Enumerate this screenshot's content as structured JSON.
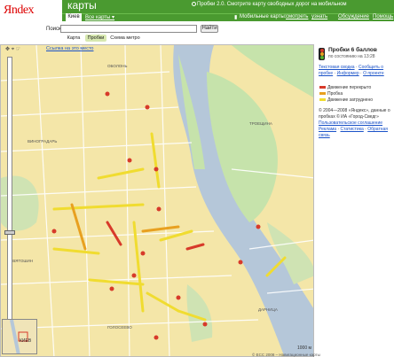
{
  "header": {
    "logo": "Яndex",
    "service_title": "карты",
    "promo_text": "Пробки 2.0. Смотрите карту свободных дорог на мобильном"
  },
  "nav": {
    "city": "Киев",
    "all_maps": "Все карты ▾",
    "mobile_label": "Мобильные карты:",
    "mobile_view": "смотреть",
    "mobile_install": "узнать",
    "feedback": "Обсуждение",
    "help": "Помощь"
  },
  "search": {
    "label": "Поиск:",
    "value": "",
    "button": "Найти"
  },
  "map_tabs": [
    "Карта",
    "Пробки",
    "Схема метро"
  ],
  "map": {
    "link_here": "Ссылка на это место",
    "minimap_label": "КИЕВ",
    "scale": "1000 м",
    "copyright": "© ЕСС 2008 – Навигационные карты"
  },
  "side": {
    "traffic_title": "Пробки 6 баллов",
    "traffic_time": "по состоянию на 13:28",
    "links1": [
      "Текстовая сводка",
      "Сообщить о пробке",
      "Информер",
      "О проекте"
    ],
    "legend": [
      {
        "label": "Движение перекрыто",
        "color": "#d73a2a"
      },
      {
        "label": "Пробка",
        "color": "#e8a020"
      },
      {
        "label": "Движение затруднено",
        "color": "#f0dc30"
      }
    ],
    "copyright_line1": "© 2004—2008 «Яндекс», данные о пробках © ИА «Город-Сведг»",
    "agreement": "Пользовательское соглашение",
    "links2": [
      "Реклама",
      "Статистика",
      "Обратная связь"
    ]
  },
  "map_labels": [
    "ОБОЛОНЬ",
    "ВИНОГРАДАРЬ",
    "ТРОЕЩИНА",
    "СВЯТОШИН",
    "ДАРНИЦА",
    "ГОЛОСЕЕВО"
  ]
}
